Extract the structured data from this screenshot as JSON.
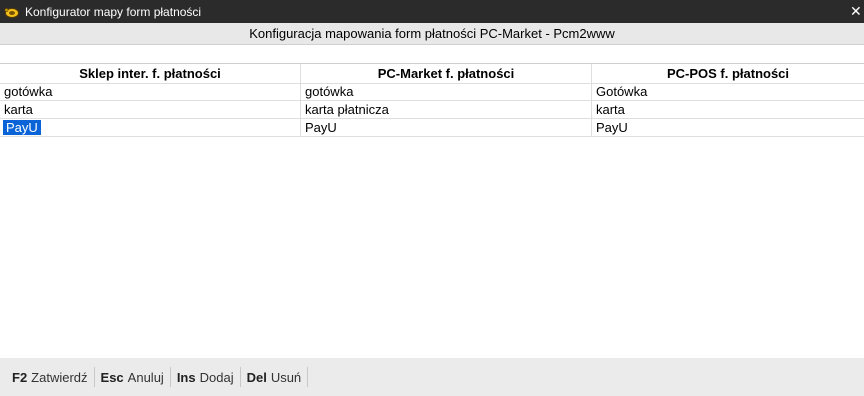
{
  "window": {
    "title": "Konfigurator mapy form płatności",
    "close_glyph": "✕"
  },
  "header": {
    "caption": "Konfiguracja mapowania form płatności PC-Market - Pcm2www"
  },
  "table": {
    "columns": [
      "Sklep inter. f. płatności",
      "PC-Market f. płatności",
      "PC-POS f. płatności"
    ],
    "rows": [
      [
        "gotówka",
        "gotówka",
        "Gotówka"
      ],
      [
        "karta",
        "karta płatnicza",
        "karta"
      ],
      [
        "PayU",
        "PayU",
        "PayU"
      ]
    ],
    "selected_row": 2,
    "selection_color": "#0a64d8"
  },
  "footer": {
    "actions": [
      {
        "key": "F2",
        "label": "Zatwierdź"
      },
      {
        "key": "Esc",
        "label": "Anuluj"
      },
      {
        "key": "Ins",
        "label": "Dodaj"
      },
      {
        "key": "Del",
        "label": "Usuń"
      }
    ]
  },
  "icons": {
    "app": "turtle-icon",
    "close": "close-icon"
  }
}
